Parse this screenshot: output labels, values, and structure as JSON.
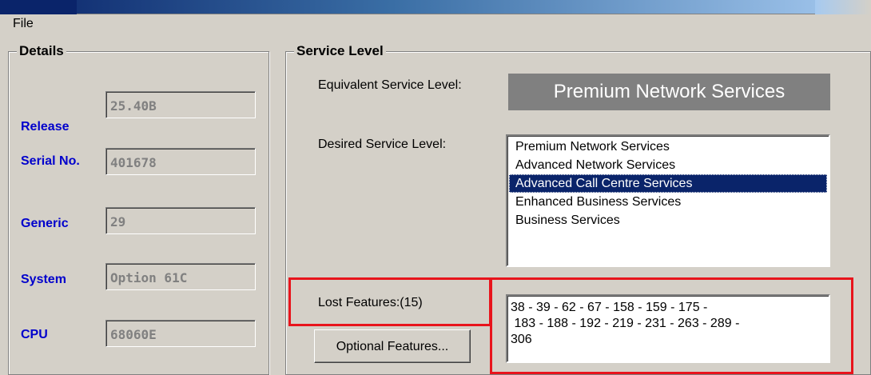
{
  "menu": {
    "file_label": "File"
  },
  "details": {
    "title": "Details",
    "fields": [
      {
        "label": "Release",
        "value": "25.40B"
      },
      {
        "label": "Serial No.",
        "value": "401678"
      },
      {
        "label": "Generic",
        "value": "29"
      },
      {
        "label": "System",
        "value": "Option 61C"
      },
      {
        "label": "CPU",
        "value": "68060E"
      }
    ]
  },
  "service": {
    "title": "Service Level",
    "equivalent_label": "Equivalent Service Level:",
    "equivalent_value": "Premium Network Services",
    "desired_label": "Desired Service Level:",
    "desired_options": [
      "Premium Network Services",
      "Advanced Network Services",
      "Advanced Call Centre Services",
      "Enhanced Business Services",
      "Business Services"
    ],
    "desired_selected": "Advanced Call Centre Services",
    "lost_label": "Lost Features:(15)",
    "lost_lines": [
      "38 - 39 - 62 - 67 - 158 - 159 - 175 -",
      " 183 - 188 - 192 - 219 - 231 - 263 - 289 -",
      "306"
    ],
    "optional_button_label": "Optional Features..."
  },
  "colors": {
    "field_label": "#0000cc",
    "selection": "#0a246a",
    "highlight": "#e8141c",
    "window_bg": "#d4d0c8"
  }
}
